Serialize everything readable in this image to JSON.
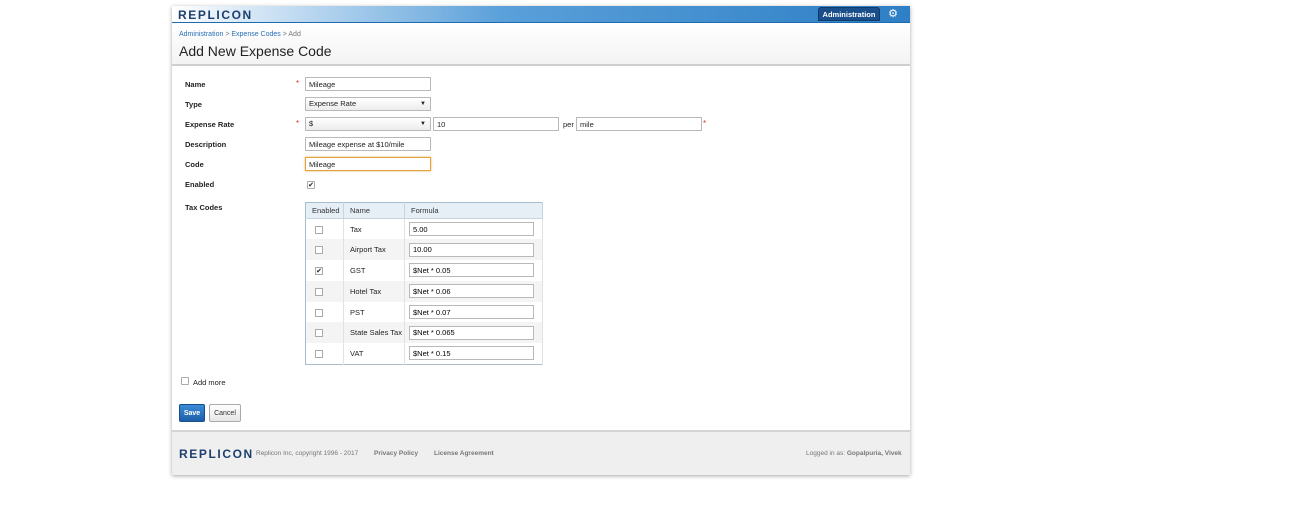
{
  "brand": {
    "logo_text": "REPLICON"
  },
  "topbar": {
    "admin_label": "Administration"
  },
  "breadcrumb": {
    "items": [
      "Administration",
      "Expense Codes",
      "Add"
    ],
    "separator": ">"
  },
  "page_title": "Add New Expense Code",
  "form": {
    "name": {
      "label": "Name",
      "value": "Mileage"
    },
    "type": {
      "label": "Type",
      "value": "Expense Rate"
    },
    "expense_rate": {
      "label": "Expense Rate",
      "currency": "$",
      "amount": "10",
      "per_label": "per",
      "unit": "mile"
    },
    "description": {
      "label": "Description",
      "value": "Mileage expense at $10/mile"
    },
    "code": {
      "label": "Code",
      "value": "Mileage"
    },
    "enabled": {
      "label": "Enabled",
      "checked": true
    },
    "tax_codes_label": "Tax Codes",
    "required_mark": "*"
  },
  "tax_table": {
    "headers": [
      "Enabled",
      "Name",
      "Formula"
    ],
    "rows": [
      {
        "enabled": false,
        "name": "Tax",
        "formula": "5.00"
      },
      {
        "enabled": false,
        "name": "Airport Tax",
        "formula": "10.00"
      },
      {
        "enabled": true,
        "name": "GST",
        "formula": "$Net * 0.05"
      },
      {
        "enabled": false,
        "name": "Hotel Tax",
        "formula": "$Net * 0.06"
      },
      {
        "enabled": false,
        "name": "PST",
        "formula": "$Net * 0.07"
      },
      {
        "enabled": false,
        "name": "State Sales Tax",
        "formula": "$Net * 0.065"
      },
      {
        "enabled": false,
        "name": "VAT",
        "formula": "$Net * 0.15"
      }
    ]
  },
  "add_more_label": "Add more",
  "buttons": {
    "save": "Save",
    "cancel": "Cancel"
  },
  "footer": {
    "copyright": "Replicon Inc, copyright 1996 - 2017",
    "privacy": "Privacy Policy",
    "license": "License Agreement",
    "logged_in_prefix": "Logged in as:",
    "user": "Gopalpuria, Vivek"
  },
  "colors": {
    "accent": "#2e7fc5",
    "brand_dark": "#1d3f6e",
    "required": "#cc3333"
  },
  "icons": {
    "settings": "gear-icon",
    "dropdown": "chevron-down-icon",
    "check": "checkmark-icon"
  }
}
